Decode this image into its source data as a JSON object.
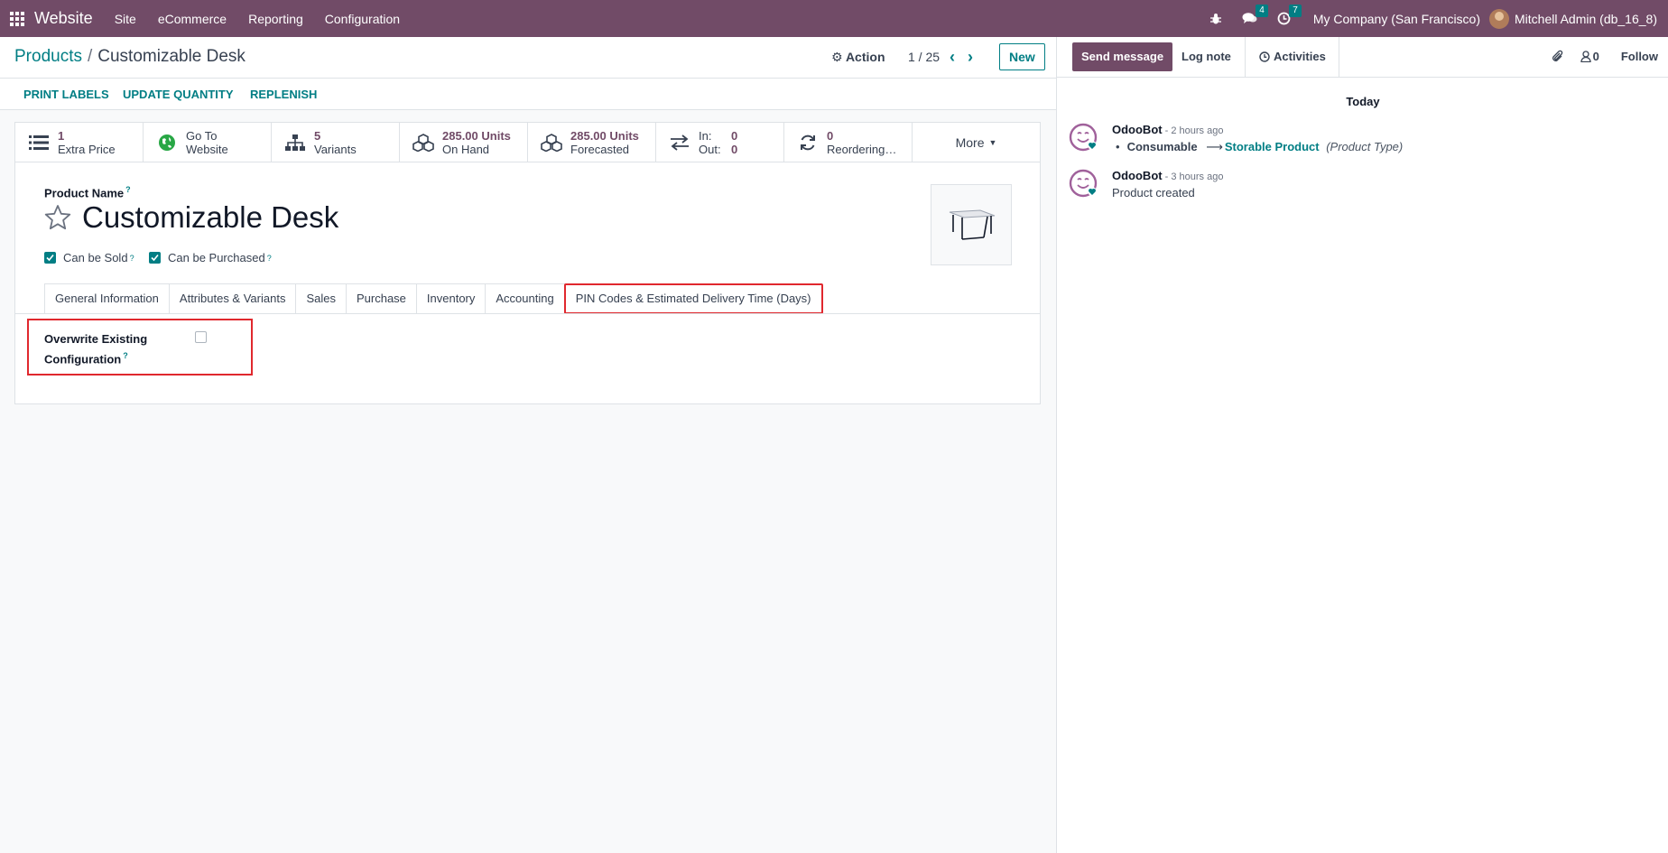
{
  "navbar": {
    "app_name": "Website",
    "menu": [
      "Site",
      "eCommerce",
      "Reporting",
      "Configuration"
    ],
    "messages_count": "4",
    "activities_count": "7",
    "company": "My Company (San Francisco)",
    "user": "Mitchell Admin (db_16_8)"
  },
  "control_panel": {
    "breadcrumb_parent": "Products",
    "breadcrumb_separator": "/",
    "breadcrumb_current": "Customizable Desk",
    "action_label": "Action",
    "pager": "1 / 25",
    "new_label": "New"
  },
  "status_bar": {
    "print_labels": "PRINT LABELS",
    "update_quantity": "UPDATE QUANTITY",
    "replenish": "REPLENISH"
  },
  "smart_buttons": {
    "extra_price_value": "1",
    "extra_price_label": "Extra Price",
    "website_line1": "Go To",
    "website_line2": "Website",
    "variants_value": "5",
    "variants_label": "Variants",
    "on_hand_value": "285.00 Units",
    "on_hand_label": "On Hand",
    "forecasted_value": "285.00 Units",
    "forecasted_label": "Forecasted",
    "in_label": "In:",
    "in_value": "0",
    "out_label": "Out:",
    "out_value": "0",
    "reordering_value": "0",
    "reordering_label": "Reordering…",
    "more_label": "More"
  },
  "form": {
    "product_name_label": "Product Name",
    "help_mark": "?",
    "product_name": "Customizable Desk",
    "can_be_sold_label": "Can be Sold",
    "can_be_purchased_label": "Can be Purchased",
    "tabs": [
      "General Information",
      "Attributes & Variants",
      "Sales",
      "Purchase",
      "Inventory",
      "Accounting",
      "PIN Codes & Estimated Delivery Time (Days)"
    ],
    "overwrite_label_line1": "Overwrite Existing",
    "overwrite_label_line2": "Configuration"
  },
  "chatter": {
    "send_message": "Send message",
    "log_note": "Log note",
    "activities": "Activities",
    "followers_count": "0",
    "follow": "Follow",
    "date_separator": "Today",
    "messages": [
      {
        "author": "OdooBot",
        "time": " - 2 hours ago",
        "bullet": "•",
        "old_value": "Consumable",
        "arrow": "⟶",
        "new_value": "Storable Product",
        "field": "(Product Type)"
      },
      {
        "author": "OdooBot",
        "time": " - 3 hours ago",
        "body": "Product created"
      }
    ]
  },
  "colors": {
    "brand": "#714b67",
    "accent": "#017e84",
    "highlight": "#e0282e"
  }
}
